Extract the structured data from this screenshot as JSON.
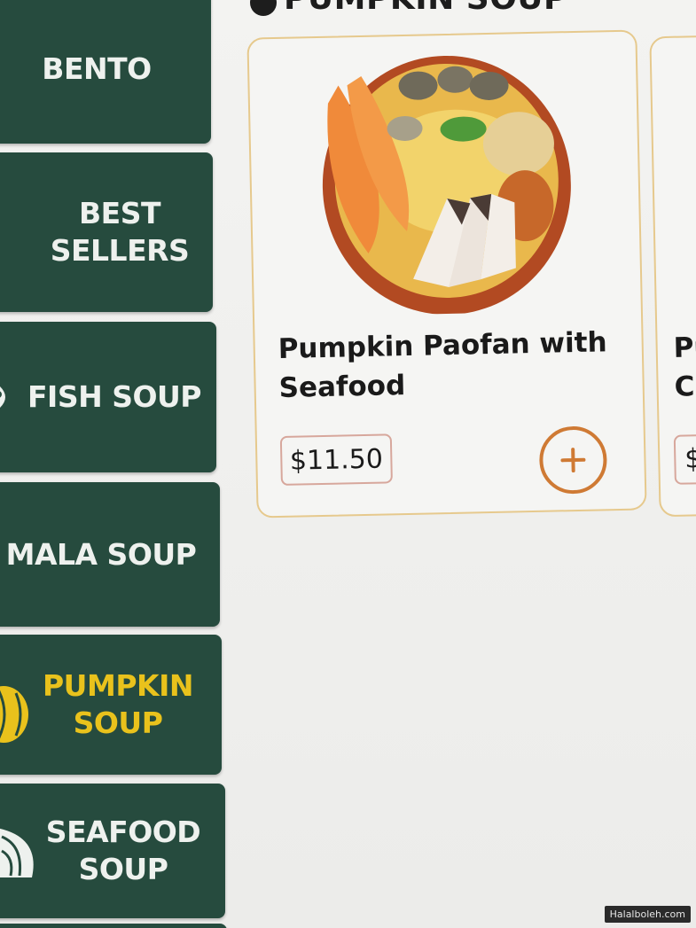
{
  "section": {
    "title": "PUMPKIN SOUP"
  },
  "categories": [
    {
      "label": "BENTO",
      "icon": "none",
      "active": false
    },
    {
      "label": "BEST\nSELLERS",
      "icon": "fish-icon",
      "active": false
    },
    {
      "label": "FISH SOUP",
      "icon": "fish-icon",
      "active": false
    },
    {
      "label": "MALA SOUP",
      "icon": "none",
      "active": false
    },
    {
      "label": "PUMPKIN\nSOUP",
      "icon": "pumpkin-icon",
      "active": true
    },
    {
      "label": "SEAFOOD\nSOUP",
      "icon": "clam-icon",
      "active": false
    }
  ],
  "products": [
    {
      "name": "Pumpkin Paofan with Seafood",
      "price": "$11.50",
      "add_icon": "plus-icon"
    },
    {
      "name": "Pu\nCh",
      "price": "$"
    }
  ],
  "colors": {
    "sidebar_bg": "#264b3e",
    "active_label": "#e9c21c",
    "card_border": "#e6c98d",
    "add_button": "#cf7a34",
    "price_border": "#d7a79c"
  },
  "watermark": "Halalboleh.com"
}
